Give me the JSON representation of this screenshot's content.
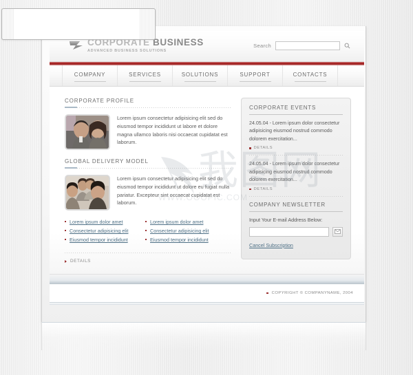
{
  "site": {
    "logo": {
      "title_light": "CORPORATE ",
      "title_strong": "BUSINESS",
      "tagline": "ADVANCED BUSINESS SOLUTIONS",
      "mark": "swoosh-logo-icon"
    },
    "search": {
      "label": "Search",
      "value": "",
      "placeholder": "",
      "button_icon": "search-icon"
    },
    "nav": [
      {
        "label": "COMPANY"
      },
      {
        "label": "SERVICES"
      },
      {
        "label": "SOLUTIONS"
      },
      {
        "label": "SUPPORT"
      },
      {
        "label": "CONTACTS"
      }
    ],
    "accent_color": "#a82020"
  },
  "main": {
    "sections": [
      {
        "title": "CORPORATE PROFILE",
        "image": "business-couple-photo",
        "body": "Lorem ipsum consectetur adipisicing elit sed do eiusmod tempor incididunt ut labore et dolore magna ullamco laboris nisi occaecat cupidatat est laborum."
      },
      {
        "title": "GLOBAL DELIVERY MODEL",
        "image": "business-group-photo",
        "body": "Lorem ipsum consectetur adipisicing elit sed do eiusmod tempor incididunt ut dolore eu fugiat nulla pariatur. Excepteur sint occaecat cupidatat est laborum."
      }
    ],
    "link_columns": [
      [
        "Lorem ipsum dolor amet",
        "Consectetur adipisicing elit",
        "Eiusmod tempor incididunt"
      ],
      [
        "Lorem ipsum dolor amet",
        "Consectetur adipisicing elit",
        "Eiusmod tempor incididunt"
      ]
    ],
    "details_label": "DETAILS"
  },
  "sidebar": {
    "events": {
      "title": "CORPORATE EVENTS",
      "items": [
        {
          "date": "24.05.04",
          "text": " - Lorem ipsum dolor consectetur adipisicing eiusmod nostrud commodo dolorem exercitation...",
          "details_label": "DETAILS"
        },
        {
          "date": "24.05.04",
          "text": " - Lorem ipsum dolor consectetur adipisicing eiusmod nostrud commodo dolorem exercitation...",
          "details_label": "DETAILS"
        }
      ]
    },
    "newsletter": {
      "title": "COMPANY NEWSLETTER",
      "prompt": "Input Your E-mail Address Below:",
      "value": "",
      "placeholder": "",
      "submit_icon": "envelope-icon",
      "cancel_label": "Cancel Subscription"
    }
  },
  "footer": {
    "copyright": "COPYRIGHT © COMPANYNAME, 2004"
  },
  "watermark": {
    "glyph": "我图网",
    "url": "WWW.OOOPIC.COM"
  }
}
